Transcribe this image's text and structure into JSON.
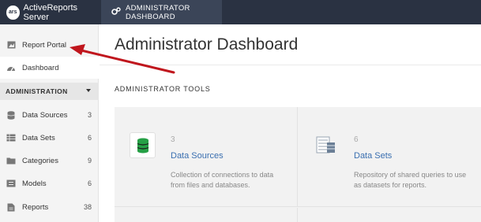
{
  "header": {
    "logo_text": "ars",
    "app_name": "ActiveReports Server",
    "active_tab": "ADMINISTRATOR DASHBOARD",
    "active_tab_icon": "gears-icon"
  },
  "sidebar": {
    "top_items": [
      {
        "label": "Report Portal",
        "icon": "image-icon"
      },
      {
        "label": "Dashboard",
        "icon": "dashboard-icon"
      }
    ],
    "section_title": "ADMINISTRATION",
    "admin_items": [
      {
        "label": "Data Sources",
        "count": "3",
        "icon": "database-icon"
      },
      {
        "label": "Data Sets",
        "count": "6",
        "icon": "table-icon"
      },
      {
        "label": "Categories",
        "count": "9",
        "icon": "folder-icon"
      },
      {
        "label": "Models",
        "count": "6",
        "icon": "list-icon"
      },
      {
        "label": "Reports",
        "count": "38",
        "icon": "document-icon"
      }
    ]
  },
  "main": {
    "title": "Administrator Dashboard",
    "tools_heading": "ADMINISTRATOR TOOLS",
    "tools": [
      {
        "count": "3",
        "name": "Data Sources",
        "description": "Collection of connections to data from files and databases.",
        "icon": "database-icon"
      },
      {
        "count": "6",
        "name": "Data Sets",
        "description": "Repository of shared queries to use as datasets for reports.",
        "icon": "dataset-icon"
      }
    ]
  },
  "colors": {
    "topbar": "#2a3242",
    "active_tab": "#3b4558",
    "link": "#3a6fb0",
    "annotation_arrow": "#c0161d",
    "database_icon": "#26a046"
  }
}
